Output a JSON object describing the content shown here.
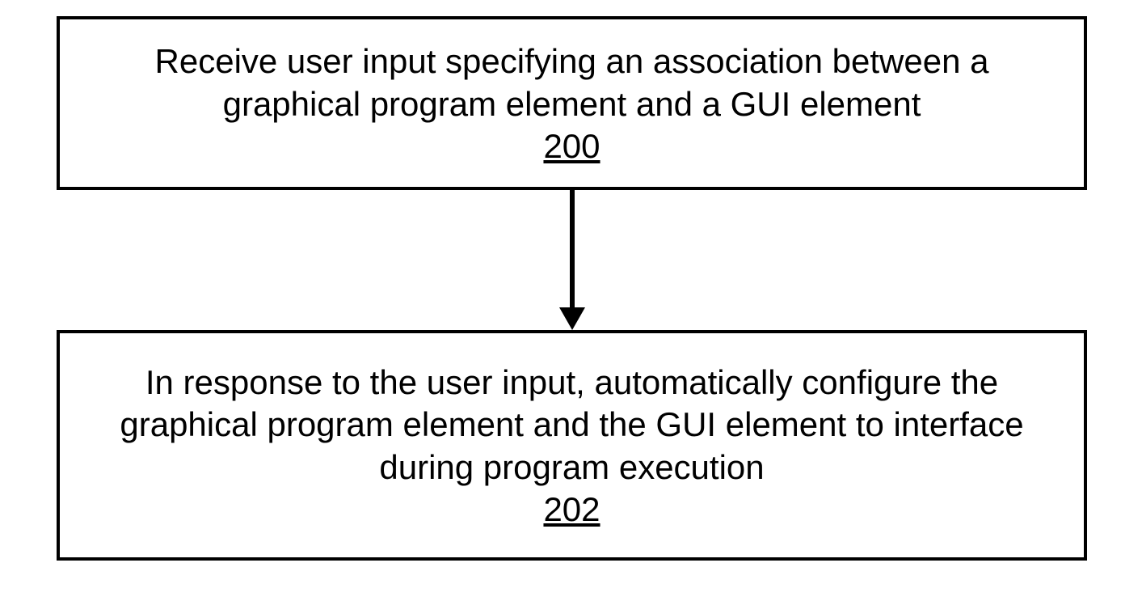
{
  "diagram": {
    "type": "flowchart",
    "nodes": [
      {
        "id": "n200",
        "text": "Receive user input specifying an association between a graphical program element and a GUI element",
        "ref": "200"
      },
      {
        "id": "n202",
        "text": "In response to the user input, automatically configure the graphical program element and the GUI element to interface during program execution",
        "ref": "202"
      }
    ],
    "edges": [
      {
        "from": "n200",
        "to": "n202"
      }
    ]
  }
}
